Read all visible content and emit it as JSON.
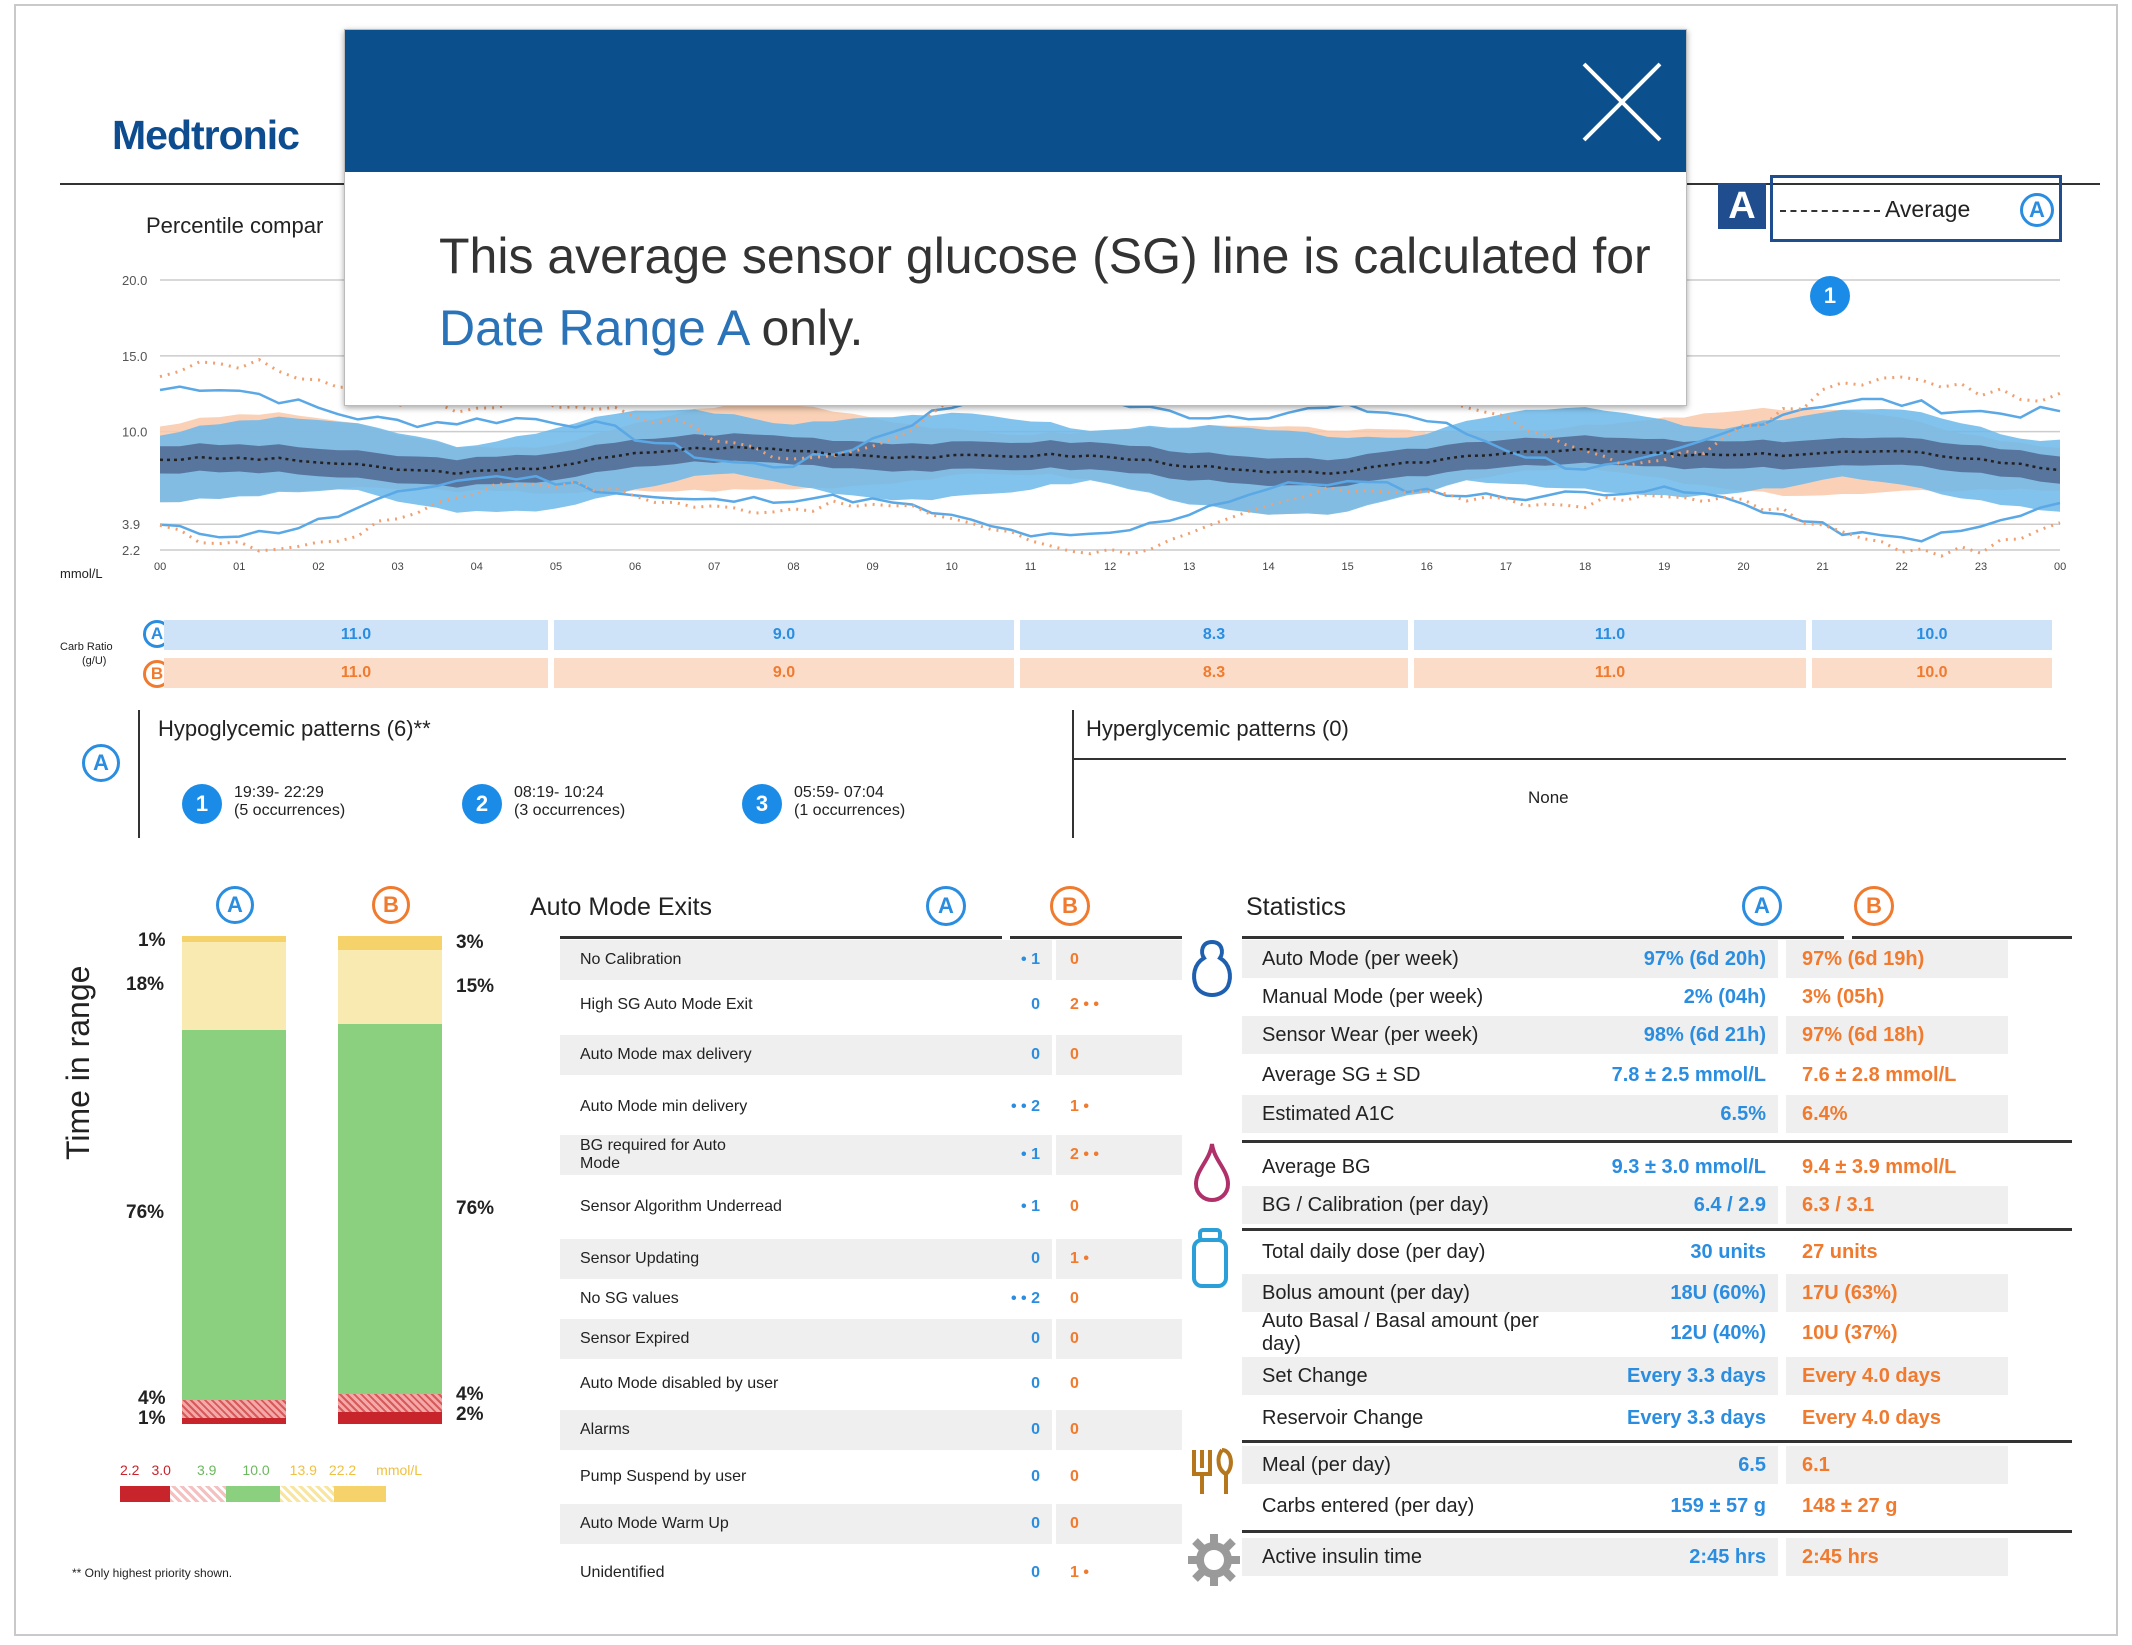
{
  "header": {
    "logo": "Medtronic"
  },
  "percentile": {
    "title": "Percentile compar"
  },
  "legend": {
    "badge": "A",
    "label": "Average",
    "series_letter": "A"
  },
  "chart_data": {
    "type": "area",
    "yticks": [
      "20.0",
      "15.0",
      "10.0",
      "3.9",
      "2.2"
    ],
    "yunit": "mmol/L",
    "xticks": [
      "00",
      "01",
      "02",
      "03",
      "04",
      "05",
      "06",
      "07",
      "08",
      "09",
      "10",
      "11",
      "12",
      "13",
      "14",
      "15",
      "16",
      "17",
      "18",
      "19",
      "20",
      "21",
      "22",
      "23",
      "00"
    ],
    "marker": "1"
  },
  "carb": {
    "label_line1": "Carb Ratio",
    "label_line2": "(g/U)",
    "a_letter": "A",
    "b_letter": "B",
    "a": [
      "11.0",
      "9.0",
      "8.3",
      "11.0",
      "10.0"
    ],
    "b": [
      "11.0",
      "9.0",
      "8.3",
      "11.0",
      "10.0"
    ]
  },
  "patterns": {
    "letter": "A",
    "hypo_title": "Hypoglycemic patterns (6)**",
    "hyper_title": "Hyperglycemic patterns (0)",
    "hyper_value": "None",
    "items": [
      {
        "n": "1",
        "time": "19:39- 22:29",
        "occ": "(5 occurrences)"
      },
      {
        "n": "2",
        "time": "08:19- 10:24",
        "occ": "(3 occurrences)"
      },
      {
        "n": "3",
        "time": "05:59- 07:04",
        "occ": "(1 occurrences)"
      }
    ]
  },
  "tir": {
    "title": "Time in range",
    "a_letter": "A",
    "b_letter": "B",
    "a_labels": [
      "1%",
      "18%",
      "76%",
      "4%",
      "1%"
    ],
    "b_labels": [
      "3%",
      "15%",
      "76%",
      "4%",
      "2%"
    ],
    "scale": [
      "2.2",
      "3.0",
      "3.9",
      "10.0",
      "13.9",
      "22.2",
      "mmol/L"
    ],
    "footnote": "** Only highest priority shown."
  },
  "ame": {
    "title": "Auto Mode Exits",
    "a_letter": "A",
    "b_letter": "B",
    "rows": [
      {
        "label": "No Calibration",
        "a": "• 1",
        "b": "0"
      },
      {
        "label": "High SG Auto Mode Exit",
        "a": "0",
        "b": "2 • •"
      },
      {
        "label": "Auto Mode max delivery",
        "a": "0",
        "b": "0"
      },
      {
        "label": "Auto Mode min delivery",
        "a": "• • 2",
        "b": "1 •"
      },
      {
        "label": "BG required for Auto Mode",
        "a": "• 1",
        "b": "2 • •"
      },
      {
        "label": "Sensor Algorithm Underread",
        "a": "• 1",
        "b": "0"
      },
      {
        "label": "Sensor Updating",
        "a": "0",
        "b": "1 •"
      },
      {
        "label": "No SG values",
        "a": "• • 2",
        "b": "0"
      },
      {
        "label": "Sensor Expired",
        "a": "0",
        "b": "0"
      },
      {
        "label": "Auto Mode disabled by user",
        "a": "0",
        "b": "0"
      },
      {
        "label": "Alarms",
        "a": "0",
        "b": "0"
      },
      {
        "label": "Pump Suspend by user",
        "a": "0",
        "b": "0"
      },
      {
        "label": "Auto Mode Warm Up",
        "a": "0",
        "b": "0"
      },
      {
        "label": "Unidentified",
        "a": "0",
        "b": "1 •"
      }
    ]
  },
  "stats": {
    "title": "Statistics",
    "a_letter": "A",
    "b_letter": "B",
    "rows": [
      {
        "label": "Auto Mode (per week)",
        "a": "97% (6d 20h)",
        "b": "97% (6d 19h)"
      },
      {
        "label": "Manual Mode (per week)",
        "a": "2% (04h)",
        "b": "3% (05h)"
      },
      {
        "label": "Sensor Wear (per week)",
        "a": "98% (6d 21h)",
        "b": "97% (6d 18h)"
      },
      {
        "label": "Average SG ± SD",
        "a": "7.8 ± 2.5 mmol/L",
        "b": "7.6 ± 2.8 mmol/L"
      },
      {
        "label": "Estimated A1C",
        "a": "6.5%",
        "b": "6.4%"
      },
      {
        "label": "Average BG",
        "a": "9.3 ± 3.0 mmol/L",
        "b": "9.4 ± 3.9 mmol/L"
      },
      {
        "label": "BG / Calibration (per day)",
        "a": "6.4 / 2.9",
        "b": "6.3 / 3.1"
      },
      {
        "label": "Total daily dose (per day)",
        "a": "30 units",
        "b": "27 units"
      },
      {
        "label": "Bolus amount (per day)",
        "a": "18U (60%)",
        "b": "17U (63%)"
      },
      {
        "label": "Auto Basal / Basal amount (per day)",
        "a": "12U (40%)",
        "b": "10U (37%)"
      },
      {
        "label": "Set Change",
        "a": "Every 3.3 days",
        "b": "Every 4.0 days"
      },
      {
        "label": "Reservoir Change",
        "a": "Every 3.3 days",
        "b": "Every 4.0 days"
      },
      {
        "label": "Meal (per day)",
        "a": "6.5",
        "b": "6.1"
      },
      {
        "label": "Carbs entered (per day)",
        "a": "159 ± 57 g",
        "b": "148 ± 27 g"
      },
      {
        "label": "Active insulin time",
        "a": "2:45 hrs",
        "b": "2:45 hrs"
      }
    ]
  },
  "popup": {
    "text_before": "This average sensor glucose (SG) line is calculated for ",
    "link": "Date Range A",
    "text_after": " only."
  },
  "colors": {
    "blue": "#2a8de0",
    "orange": "#f07a2e",
    "popup_header": "#0b4f8c"
  }
}
